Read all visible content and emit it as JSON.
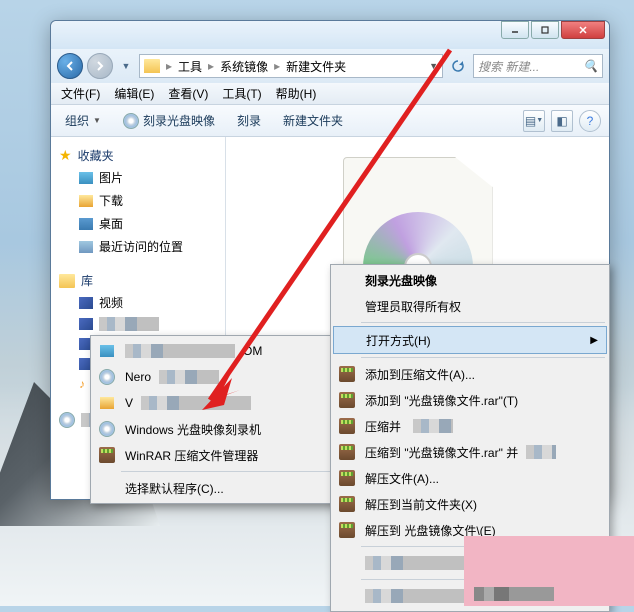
{
  "breadcrumb": [
    "工具",
    "系统镜像",
    "新建文件夹"
  ],
  "search_placeholder": "搜索 新建...",
  "menubar": [
    {
      "label": "文件(F)"
    },
    {
      "label": "编辑(E)"
    },
    {
      "label": "查看(V)"
    },
    {
      "label": "工具(T)"
    },
    {
      "label": "帮助(H)"
    }
  ],
  "toolbar": {
    "organize": "组织",
    "burn_image": "刻录光盘映像",
    "burn": "刻录",
    "new_folder": "新建文件夹"
  },
  "sidebar": {
    "favorites": "收藏夹",
    "fav_items": [
      {
        "label": "图片"
      },
      {
        "label": "下载"
      },
      {
        "label": "桌面"
      },
      {
        "label": "最近访问的位置"
      }
    ],
    "libraries": "库",
    "lib_items": [
      {
        "label": "视频"
      }
    ]
  },
  "open_with_menu": {
    "items": [
      {
        "label": "OM",
        "pixelated": true
      },
      {
        "label": "Nero",
        "pixelated": true
      },
      {
        "label": "V",
        "pixelated": true
      },
      {
        "label": "Windows 光盘映像刻录机"
      },
      {
        "label": "WinRAR 压缩文件管理器"
      }
    ],
    "choose_default": "选择默认程序(C)..."
  },
  "context_menu": {
    "burn_image": "刻录光盘映像",
    "admin_rights": "管理员取得所有权",
    "open_with": "打开方式(H)",
    "add_to_archive": "添加到压缩文件(A)...",
    "add_to_rar": "添加到 \"光盘镜像文件.rar\"(T)",
    "compress_and": "压缩并",
    "compress_to_rar": "压缩到 \"光盘镜像文件.rar\" 并",
    "extract_files": "解压文件(A)...",
    "extract_here": "解压到当前文件夹(X)",
    "extract_to": "解压到 光盘镜像文件\\(E)"
  }
}
